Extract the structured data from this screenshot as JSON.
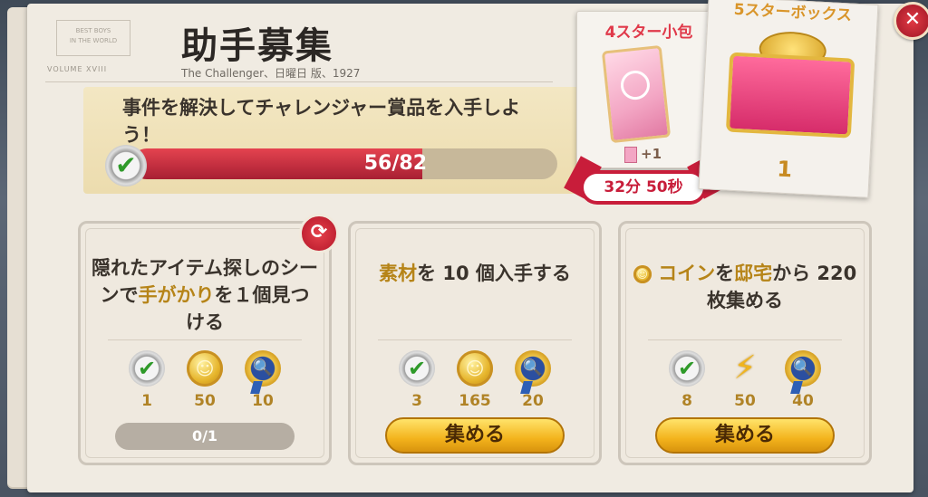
{
  "header": {
    "title": "助手募集",
    "subtitle": "The Challenger、日曜日 版、1927",
    "stamp": "BEST BOYS\nIN THE WORLD",
    "volume_text": "VOLUME XVIII"
  },
  "challenge": {
    "text": "事件を解決してチャレンジャー賞品を入手しよう！",
    "progress_label": "56/82",
    "progress_current": 56,
    "progress_total": 82
  },
  "rewards_preview": {
    "pack_title": "4スター小包",
    "pack_plus": "+1",
    "timer": "32分 50秒",
    "box_title": "5スターボックス",
    "box_count": "1"
  },
  "tasks": [
    {
      "title_parts": [
        "隠れたアイテム探しのシーンで",
        "手がかり",
        "を１個見つける"
      ],
      "rewards": [
        {
          "icon": "check-icon",
          "value": "1"
        },
        {
          "icon": "coin-icon",
          "value": "50"
        },
        {
          "icon": "clue-medal-icon",
          "value": "10"
        }
      ],
      "progress": "0/1"
    },
    {
      "title_parts": [
        "素材",
        "を 10 個入手する"
      ],
      "rewards": [
        {
          "icon": "check-icon",
          "value": "3"
        },
        {
          "icon": "coin-icon",
          "value": "165"
        },
        {
          "icon": "clue-medal-icon",
          "value": "20"
        }
      ],
      "button": "集める"
    },
    {
      "title_parts": [
        "コイン",
        "を",
        "邸宅",
        "から 220 枚集める"
      ],
      "rewards": [
        {
          "icon": "check-icon",
          "value": "8"
        },
        {
          "icon": "energy-icon",
          "value": "50"
        },
        {
          "icon": "clue-medal-icon",
          "value": "40"
        }
      ],
      "button": "集める"
    }
  ],
  "icons": {
    "close": "✕",
    "check": "✔",
    "refresh": "⟳",
    "bolt": "⚡"
  }
}
